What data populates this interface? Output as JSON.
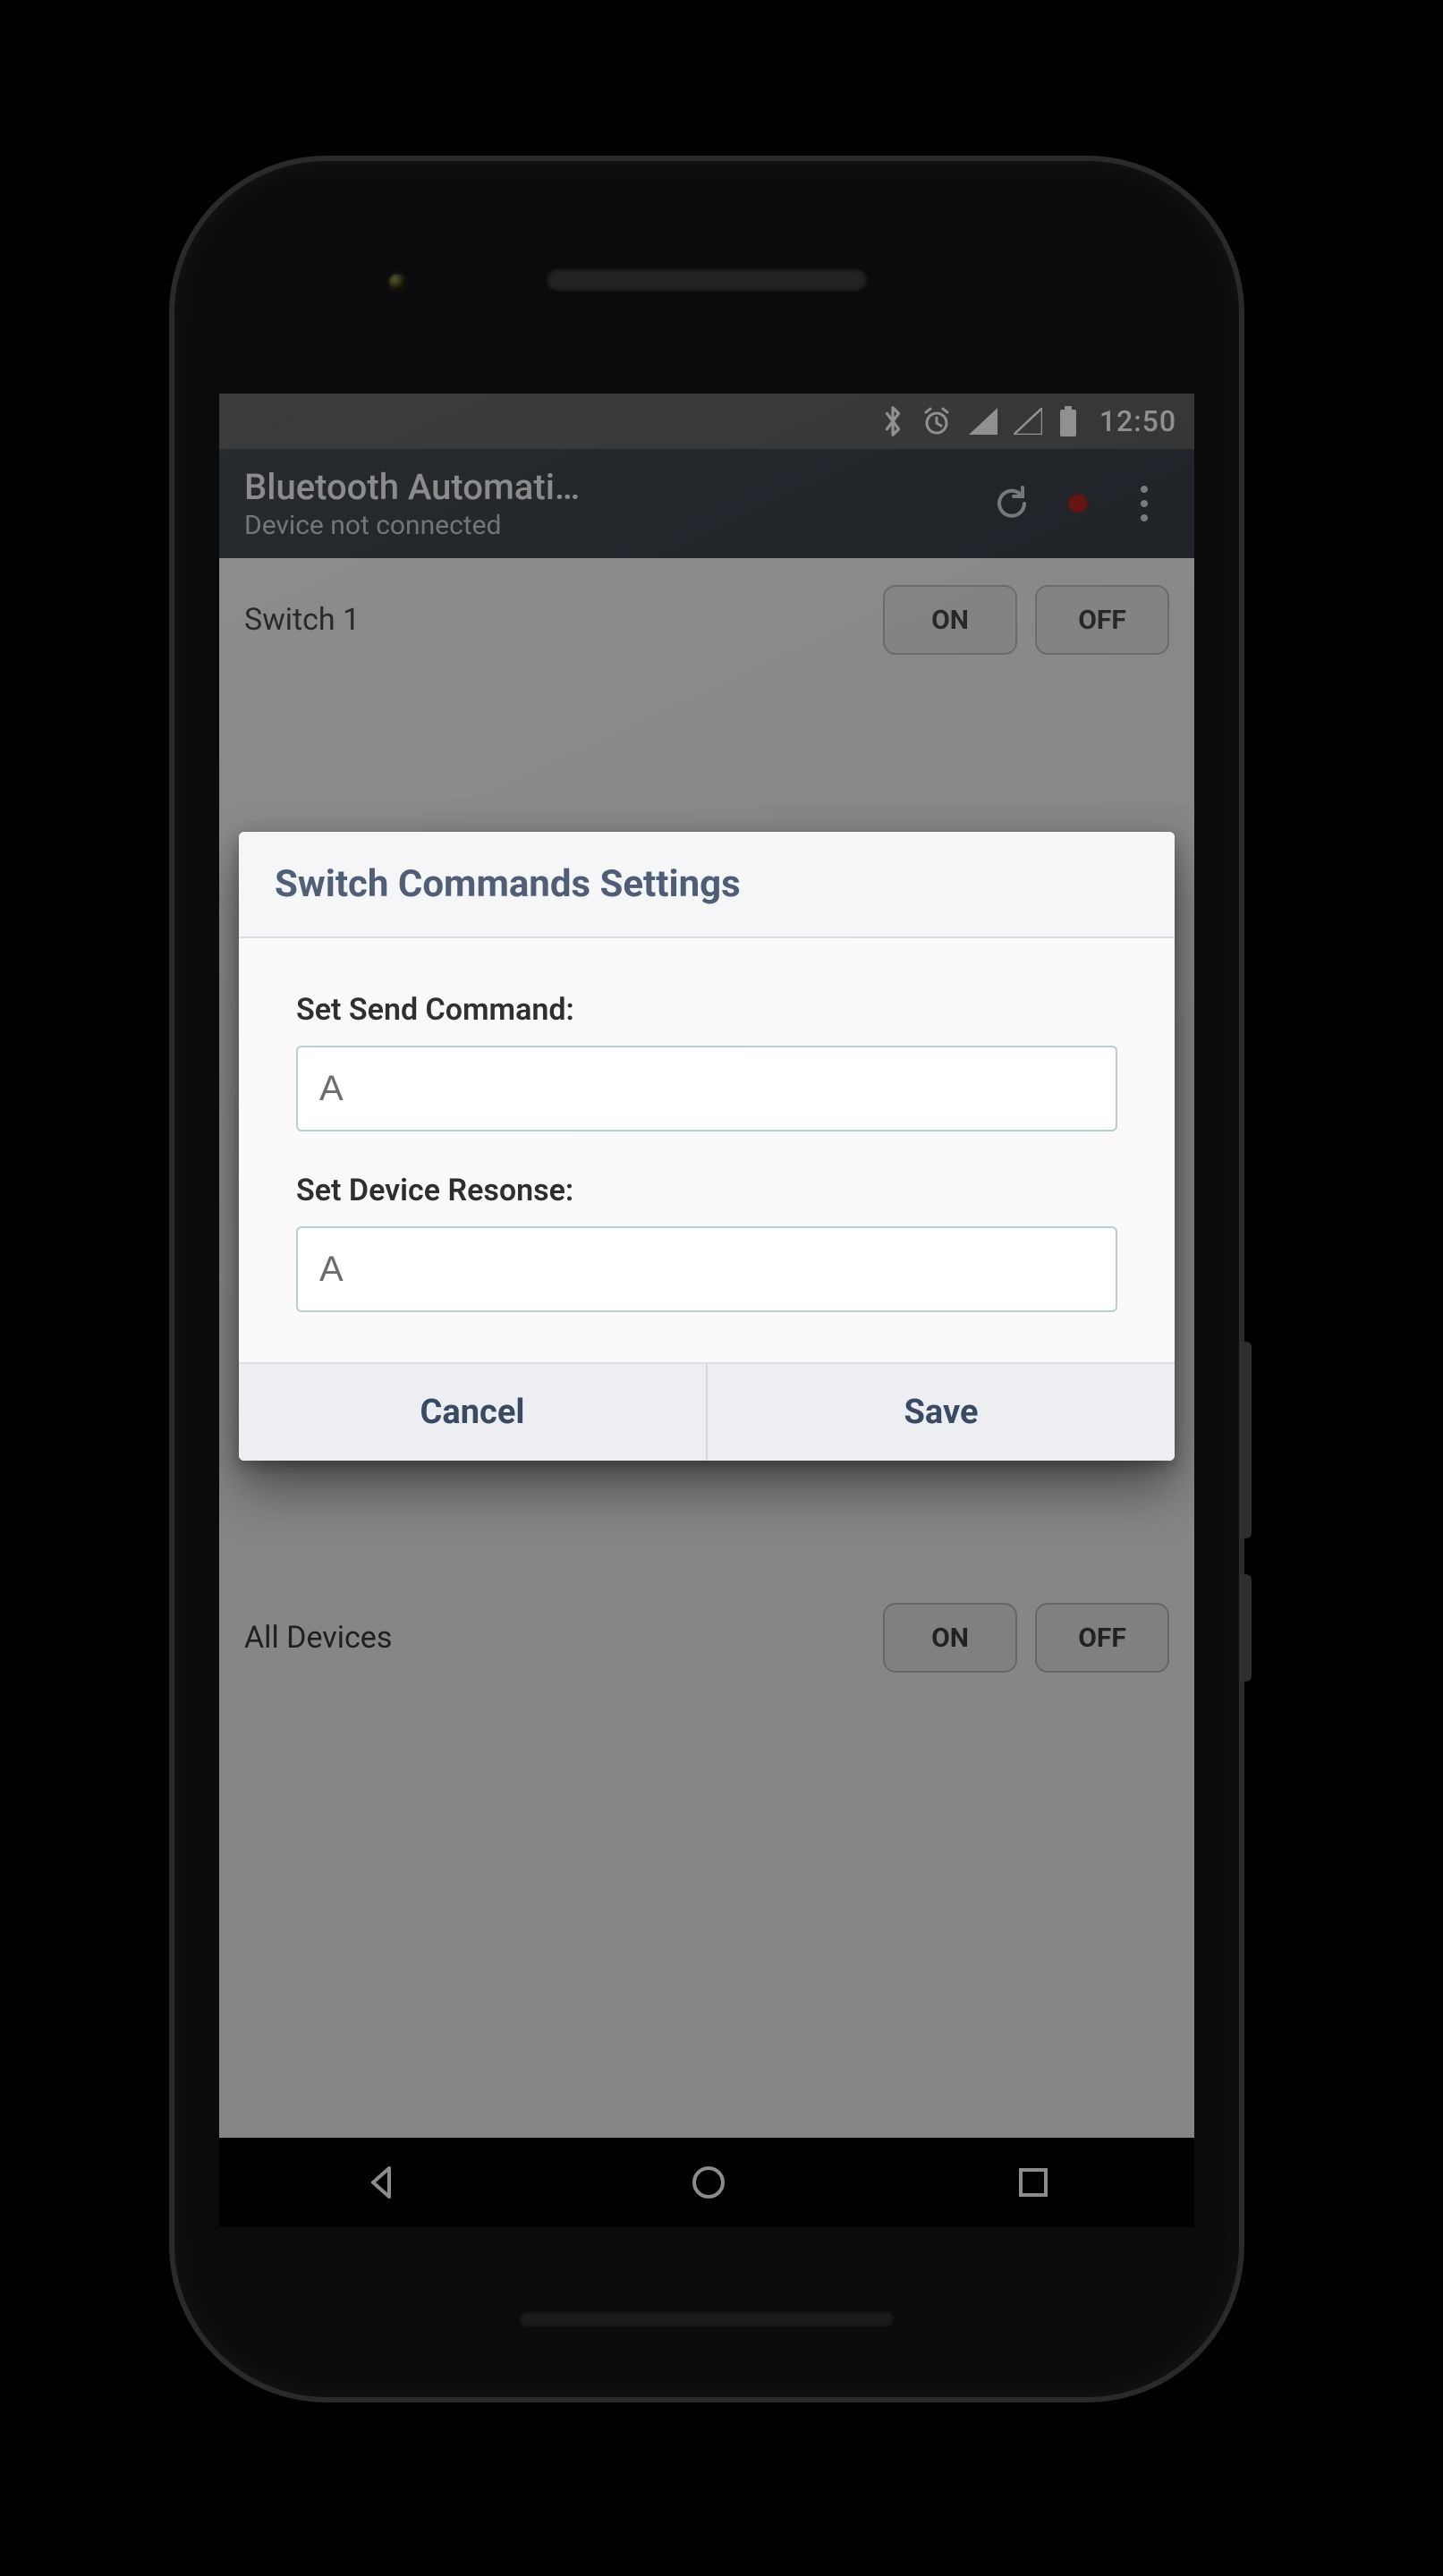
{
  "statusbar": {
    "time": "12:50"
  },
  "toolbar": {
    "title": "Bluetooth Automati…",
    "subtitle": "Device not connected"
  },
  "rows": [
    {
      "label": "Switch 1",
      "on": "ON",
      "off": "OFF"
    },
    {
      "label": "All Devices",
      "on": "ON",
      "off": "OFF"
    }
  ],
  "dialog": {
    "title": "Switch Commands Settings",
    "send_label": "Set Send Command:",
    "send_value": "A",
    "resp_label": "Set Device Resonse:",
    "resp_value": "A",
    "cancel": "Cancel",
    "save": "Save"
  }
}
